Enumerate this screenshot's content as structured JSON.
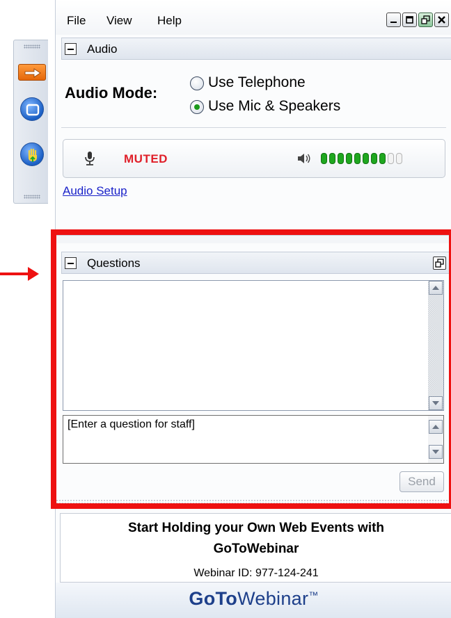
{
  "menu": [
    "File",
    "View",
    "Help"
  ],
  "audio": {
    "title": "Audio",
    "mode_label": "Audio Mode:",
    "options": [
      {
        "label": "Use Telephone",
        "selected": false
      },
      {
        "label": "Use Mic & Speakers",
        "selected": true
      }
    ],
    "mute_status": "MUTED",
    "volume_level": 0.8,
    "setup_link": "Audio Setup"
  },
  "questions": {
    "title": "Questions",
    "input_placeholder": "[Enter a question for staff]",
    "send_label": "Send"
  },
  "promo": {
    "line1": "Start Holding your Own Web Events with",
    "line2": "GoToWebinar",
    "webinar_id": "Webinar ID: 977-124-241"
  },
  "brand": {
    "bold": "GoTo",
    "regular": "Webinar",
    "tm": "™"
  },
  "colors": {
    "muted": "#e0202a",
    "highlight": "#ee1111",
    "link": "#1a22c9",
    "brand": "#1d3f8a"
  }
}
